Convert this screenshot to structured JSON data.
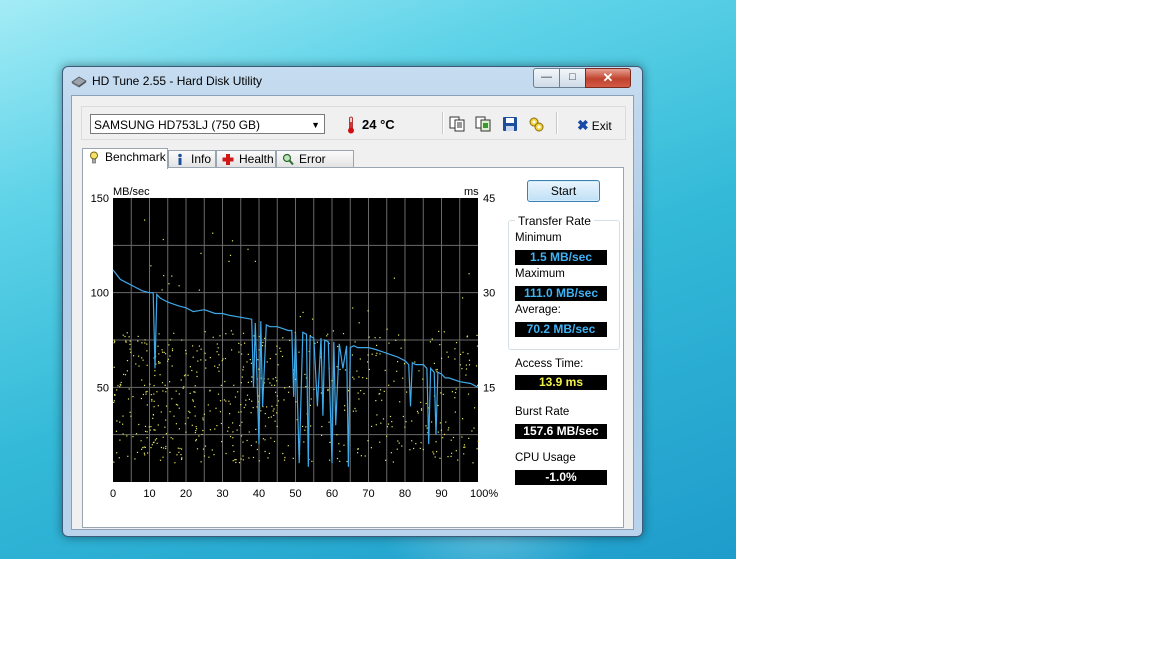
{
  "window": {
    "title": "HD Tune 2.55 - Hard Disk Utility",
    "min_label": "—",
    "max_label": "□",
    "close_label": "✕"
  },
  "toolbar": {
    "drive": "SAMSUNG HD753LJ (750 GB)",
    "temperature": "24 °C",
    "exit_label": "Exit",
    "icons": [
      "copy-text-icon",
      "copy-image-icon",
      "save-icon",
      "options-icon",
      "exit-icon"
    ]
  },
  "tabs": [
    {
      "label": "Benchmark",
      "icon": "benchmark-icon",
      "active": true
    },
    {
      "label": "Info",
      "icon": "info-icon",
      "active": false
    },
    {
      "label": "Health",
      "icon": "health-icon",
      "active": false
    },
    {
      "label": "Error Scan",
      "icon": "error-scan-icon",
      "active": false
    }
  ],
  "benchmark": {
    "start_label": "Start",
    "transfer_rate_label": "Transfer Rate",
    "minimum_label": "Minimum",
    "minimum_value": "1.5 MB/sec",
    "maximum_label": "Maximum",
    "maximum_value": "111.0 MB/sec",
    "average_label": "Average:",
    "average_value": "70.2 MB/sec",
    "access_time_label": "Access Time:",
    "access_time_value": "13.9 ms",
    "burst_rate_label": "Burst Rate",
    "burst_rate_value": "157.6 MB/sec",
    "cpu_usage_label": "CPU Usage",
    "cpu_usage_value": "-1.0%"
  },
  "colors": {
    "transfer_line": "#3fa9ea",
    "access_points": "#e8e860",
    "plot_bg": "#000000",
    "grid": "#6a6a6a"
  },
  "chart_data": {
    "type": "line",
    "left_axis_label": "MB/sec",
    "right_axis_label": "ms",
    "y_left_ticks": [
      "150",
      "100",
      "50"
    ],
    "y_right_ticks": [
      "45",
      "30",
      "15"
    ],
    "x_ticks": [
      "0",
      "10",
      "20",
      "30",
      "40",
      "50",
      "60",
      "70",
      "80",
      "90",
      "100%"
    ],
    "xlim": [
      0,
      100
    ],
    "ylim_left": [
      0,
      150
    ],
    "ylim_right": [
      0,
      45
    ],
    "grid": true,
    "series": [
      {
        "values_x": [
          0,
          2,
          4,
          6,
          8,
          10,
          11,
          11.5,
          12,
          13,
          15,
          18,
          20,
          22,
          25,
          28,
          30,
          32,
          35,
          38,
          38.5,
          39,
          40,
          40.5,
          41,
          42,
          43,
          45,
          48,
          49,
          49.5,
          50,
          51,
          52,
          53,
          53.5,
          54,
          55,
          56,
          57,
          57.5,
          58,
          59,
          60,
          60.5,
          61,
          62,
          63,
          64,
          64.5,
          65,
          66,
          67,
          70,
          72,
          75,
          78,
          80,
          81,
          81.5,
          82,
          83,
          85,
          86,
          86.5,
          87,
          88,
          88.5,
          89,
          90,
          91,
          92,
          95,
          98,
          100
        ],
        "values_y": [
          112,
          107,
          105,
          103,
          101,
          100,
          100,
          60,
          99,
          97,
          95,
          93,
          92,
          90,
          91,
          89,
          89,
          88,
          87,
          86,
          50,
          84,
          20,
          85,
          40,
          83,
          82,
          82,
          80,
          80,
          45,
          79,
          10,
          79,
          78,
          8,
          77,
          76,
          40,
          76,
          35,
          75,
          74,
          10,
          74,
          30,
          73,
          60,
          72,
          8,
          71,
          72,
          71,
          71,
          70,
          68,
          66,
          64,
          62,
          40,
          63,
          62,
          62,
          60,
          20,
          60,
          58,
          25,
          58,
          57,
          55,
          55,
          53,
          52,
          50
        ]
      }
    ],
    "access_time_scatter": "dense cloud of points mostly between 3 and 24 ms across the full range, with sparse outliers up to ~42 ms"
  }
}
